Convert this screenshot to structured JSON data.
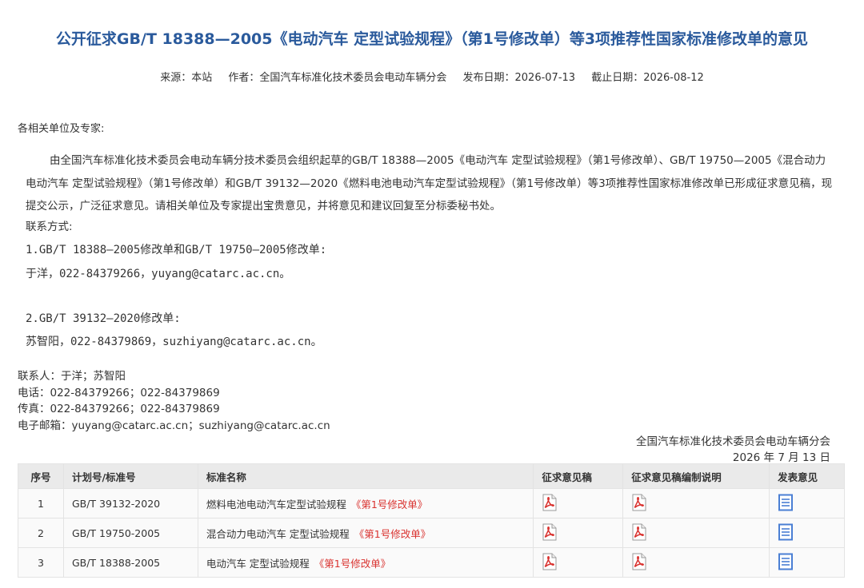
{
  "page": {
    "title": "公开征求GB/T 18388—2005《电动汽车 定型试验规程》（第1号修改单）等3项推荐性国家标准修改单的意见",
    "meta": {
      "source": "来源：本站",
      "author": "作者：全国汽车标准化技术委员会电动车辆分会",
      "publish_date": "发布日期：2026-07-13",
      "deadline": "截止日期：2026-08-12"
    }
  },
  "letter": {
    "greeting": "各相关单位及专家:",
    "body": "由全国汽车标准化技术委员会电动车辆分技术委员会组织起草的GB/T 18388—2005《电动汽车 定型试验规程》（第1号修改单）、GB/T 19750—2005《混合动力电动汽车 定型试验规程》（第1号修改单）和GB/T 39132—2020《燃料电池电动汽车定型试验规程》（第1号修改单）等3项推荐性国家标准修改单已形成征求意见稿，现提交公示，广泛征求意见。请相关单位及专家提出宝贵意见，并将意见和建议回复至分标委秘书处。",
    "contact_heading": "联系方式:",
    "group1_title": "1.GB/T 18388—2005修改单和GB/T 19750—2005修改单:",
    "group1_contact": "于洋，022-84379266，yuyang@catarc.ac.cn。",
    "group2_title": "2.GB/T 39132—2020修改单:",
    "group2_contact": "苏智阳，022-84379869，suzhiyang@catarc.ac.cn。",
    "contact_person": "联系人：于洋；苏智阳",
    "phone": "电话：022-84379266；022-84379869",
    "fax": "传真：022-84379266；022-84379869",
    "email": "电子邮箱：yuyang@catarc.ac.cn；suzhiyang@catarc.ac.cn",
    "signature_org": "全国汽车标准化技术委员会电动车辆分会",
    "signature_date": "2026 年 7 月 13 日"
  },
  "table": {
    "headers": [
      "序号",
      "计划号/标准号",
      "标准名称",
      "征求意见稿",
      "征求意见稿编制说明",
      "发表意见"
    ],
    "rows": [
      {
        "no": "1",
        "code": "GB/T 39132-2020",
        "name": "燃料电池电动汽车定型试验规程",
        "tag": "《第1号修改单》"
      },
      {
        "no": "2",
        "code": "GB/T 19750-2005",
        "name": "混合动力电动汽车 定型试验规程",
        "tag": "《第1号修改单》"
      },
      {
        "no": "3",
        "code": "GB/T 18388-2005",
        "name": "电动汽车 定型试验规程",
        "tag": "《第1号修改单》"
      }
    ]
  },
  "icons": {
    "pdf": "pdf-file-icon",
    "comment": "comment-form-icon",
    "pdf_color": "#d9322f",
    "doc_color": "#4a7fd4"
  }
}
